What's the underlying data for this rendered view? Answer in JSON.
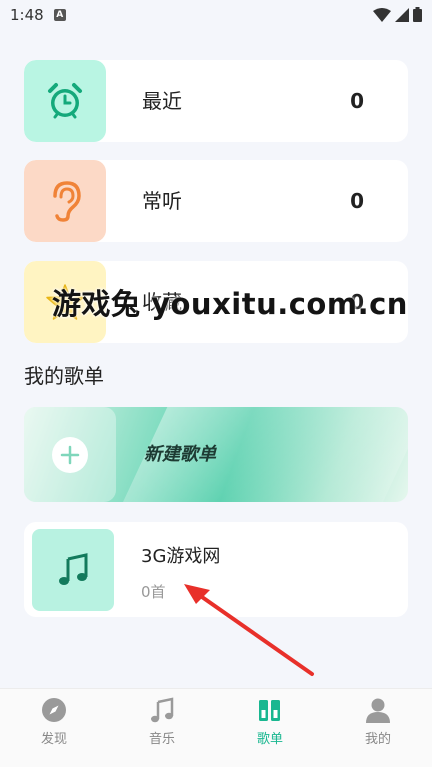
{
  "status_bar": {
    "time": "1:48",
    "notification_icon": "A"
  },
  "library": [
    {
      "label": "最近",
      "count": "0",
      "icon": "alarm-clock-icon",
      "tile_color": "#b9f5e3"
    },
    {
      "label": "常听",
      "count": "0",
      "icon": "ear-icon",
      "tile_color": "#fcd9c6"
    },
    {
      "label": "收藏",
      "count": "0",
      "icon": "star-icon",
      "tile_color": "#fff4c2"
    }
  ],
  "section_title": "我的歌单",
  "new_playlist": {
    "label": "新建歌单",
    "icon": "plus-icon"
  },
  "playlists": [
    {
      "name": "3G游戏网",
      "count": "0首",
      "icon": "music-note-icon"
    }
  ],
  "watermark": "游戏兔 youxitu.com.cn",
  "nav": [
    {
      "label": "发现",
      "icon": "compass-icon",
      "active": false
    },
    {
      "label": "音乐",
      "icon": "music-note-icon",
      "active": false
    },
    {
      "label": "歌单",
      "icon": "playlist-icon",
      "active": true
    },
    {
      "label": "我的",
      "icon": "person-icon",
      "active": false
    }
  ],
  "colors": {
    "accent": "#19b790",
    "background": "#f4f6fb",
    "annotation_arrow": "#e8302a"
  }
}
